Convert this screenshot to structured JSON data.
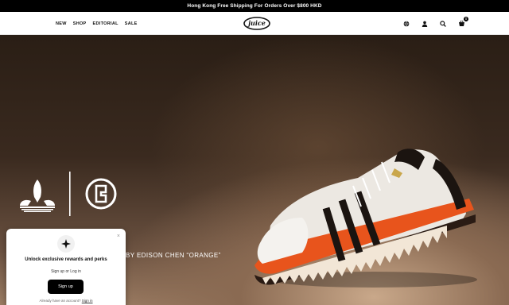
{
  "announcement": "Hong Kong Free Shipping For Orders Over $800 HKD",
  "nav": {
    "items": [
      "NEW",
      "SHOP",
      "EDITORIAL",
      "SALE"
    ]
  },
  "header": {
    "logo": "juice",
    "cart_count": "0"
  },
  "icons": [
    "globe-icon",
    "account-icon",
    "search-icon",
    "cart-icon"
  ],
  "hero": {
    "title": "BY EDISON CHEN “ORANGE”"
  },
  "popup": {
    "title": "Unlock exclusive rewards and perks",
    "subtitle": "Sign up or Log in",
    "button": "Sign up",
    "footer_prefix": "Already have an account?",
    "footer_link": "Sign in",
    "close": "×"
  },
  "colors": {
    "accent": "#e8541c",
    "bar": "#000000"
  }
}
